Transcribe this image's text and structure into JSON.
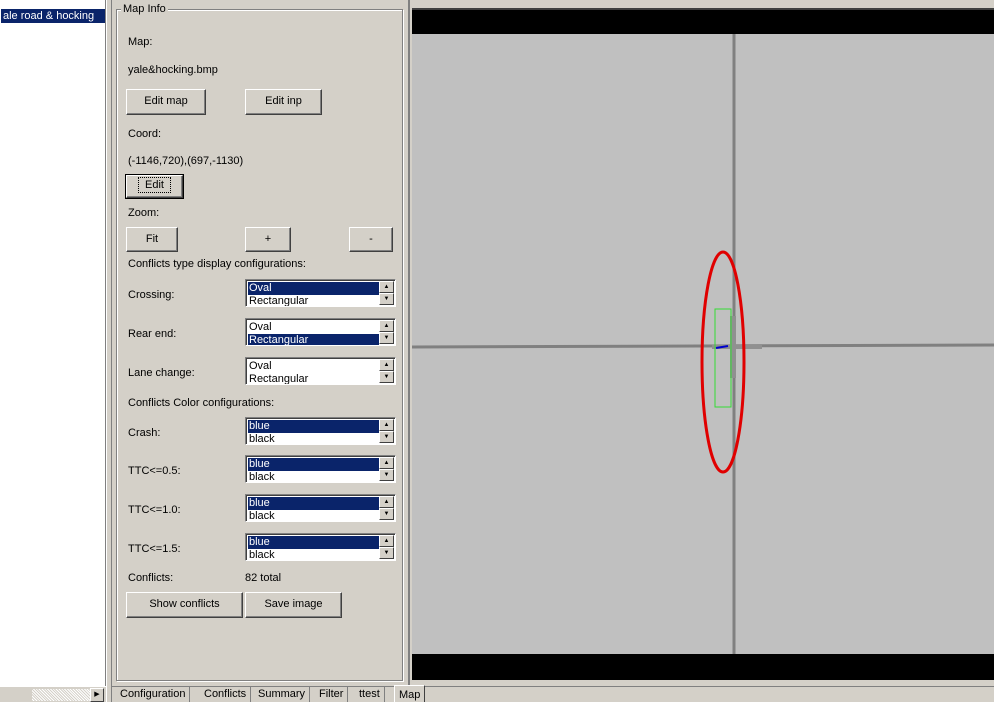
{
  "tree": {
    "selected_item": "ale road & hocking"
  },
  "group_title": "Map Info",
  "map_label": "Map:",
  "map_file": "yale&hocking.bmp",
  "buttons": {
    "edit_map": "Edit map",
    "edit_inp": "Edit inp",
    "edit": "Edit",
    "fit": "Fit",
    "zoom_in": "+",
    "zoom_out": "-",
    "show_conflicts": "Show conflicts",
    "save_image": "Save image"
  },
  "coord_label": "Coord:",
  "coord_value": "(-1146,720),(697,-1130)",
  "zoom_label": "Zoom:",
  "conflict_type_heading": "Conflicts type display configurations:",
  "type_rows": [
    {
      "label": "Crossing:",
      "options": [
        "Oval",
        "Rectangular"
      ],
      "selected": 0
    },
    {
      "label": "Rear end:",
      "options": [
        "Oval",
        "Rectangular"
      ],
      "selected": 1
    },
    {
      "label": "Lane change:",
      "options": [
        "Oval",
        "Rectangular"
      ],
      "selected": -1
    }
  ],
  "color_heading": "Conflicts Color configurations:",
  "color_rows": [
    {
      "label": "Crash:",
      "options": [
        "blue",
        "black"
      ],
      "selected": 0
    },
    {
      "label": "TTC<=0.5:",
      "options": [
        "blue",
        "black"
      ],
      "selected": 0
    },
    {
      "label": "TTC<=1.0:",
      "options": [
        "blue",
        "black"
      ],
      "selected": 0
    },
    {
      "label": "TTC<=1.5:",
      "options": [
        "blue",
        "black"
      ],
      "selected": 0
    }
  ],
  "conflicts_label": "Conflicts:",
  "conflicts_value": "82 total",
  "tabs": [
    "Configuration",
    "Conflicts",
    "Summary",
    "Filter",
    "ttest",
    "Map"
  ],
  "active_tab": "Map",
  "colors": {
    "selection": "#0a246a",
    "panel": "#d4d0c8",
    "map_bg": "#c0c0c0",
    "road": "#808080",
    "highlight_oval": "#e00000",
    "highlight_box": "#33dd33"
  }
}
